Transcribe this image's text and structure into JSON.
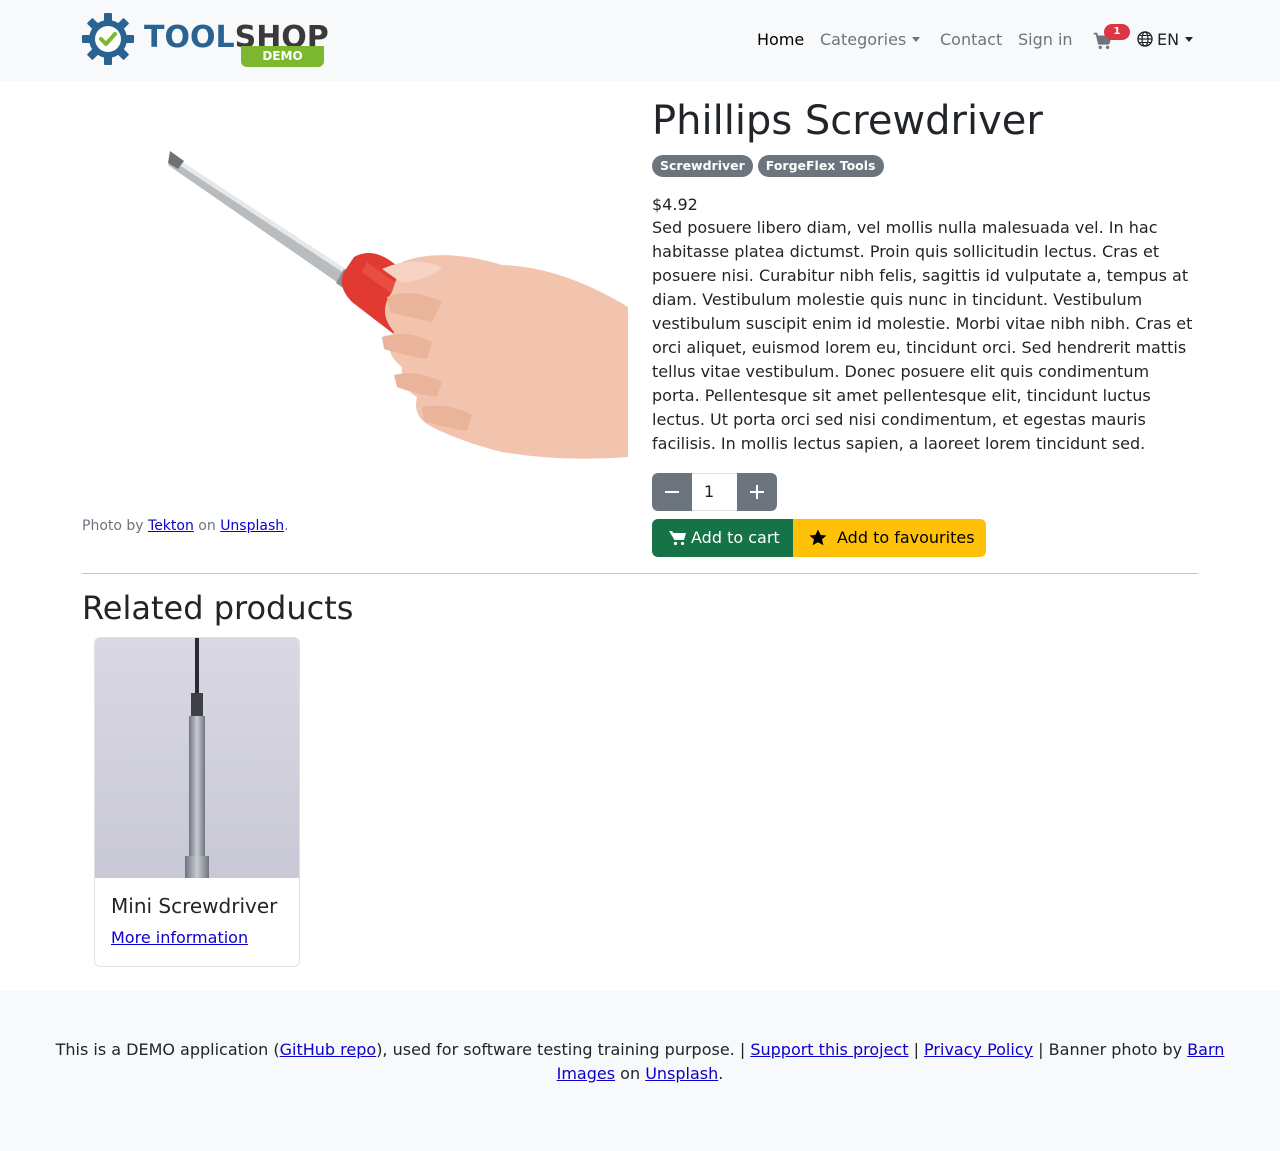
{
  "header": {
    "logo": {
      "word_tool": "TOOL",
      "word_shop": "SHOP",
      "demo": "DEMO"
    },
    "nav": {
      "home": "Home",
      "categories": "Categories",
      "contact": "Contact",
      "sign_in": "Sign in"
    },
    "cart_count": "1",
    "language": "EN"
  },
  "product": {
    "title": "Phillips Screwdriver",
    "tags": [
      "Screwdriver",
      "ForgeFlex Tools"
    ],
    "price": "$4.92",
    "description": "Sed posuere libero diam, vel mollis nulla malesuada vel. In hac habitasse platea dictumst. Proin quis sollicitudin lectus. Cras et posuere nisi. Curabitur nibh felis, sagittis id vulputate a, tempus at diam. Vestibulum molestie quis nunc in tincidunt. Vestibulum vestibulum suscipit enim id molestie. Morbi vitae nibh nibh. Cras et orci aliquet, euismod lorem eu, tincidunt orci. Sed hendrerit mattis tellus vitae vestibulum. Donec posuere elit quis condimentum porta. Pellentesque sit amet pellentesque elit, tincidunt luctus lectus. Ut porta orci sed nisi condimentum, et egestas mauris facilisis. In mollis lectus sapien, a laoreet lorem tincidunt sed.",
    "quantity": "1",
    "add_to_cart": "Add to cart",
    "add_to_favourites": "Add to favourites",
    "credit": {
      "prefix": "Photo by ",
      "author": "Tekton",
      "middle": " on ",
      "site": "Unsplash",
      "suffix": "."
    }
  },
  "related": {
    "heading": "Related products",
    "items": [
      {
        "title": "Mini Screwdriver",
        "link": "More information"
      }
    ]
  },
  "footer": {
    "t1": "This is a DEMO application (",
    "github": "GitHub repo",
    "t2": "), used for software testing training purpose. | ",
    "support": "Support this project",
    "t3": " | ",
    "privacy": "Privacy Policy",
    "t4": " | Banner photo by ",
    "barn": "Barn Images",
    "t5": " on ",
    "unsplash": "Unsplash",
    "t6": "."
  },
  "colors": {
    "navbar_bg": "#f8f9fa",
    "cart_button": "#157347",
    "favourite_button": "#ffc107",
    "badge": "#6c757d",
    "cart_badge": "#dc3545",
    "link": "#0d00cc"
  },
  "icons": {
    "logo": "gear-check-icon",
    "cart": "shopping-cart-icon",
    "language": "globe-icon",
    "minus": "minus-icon",
    "plus": "plus-icon",
    "add_to_cart": "shopping-cart-icon",
    "favourite": "star-icon"
  }
}
